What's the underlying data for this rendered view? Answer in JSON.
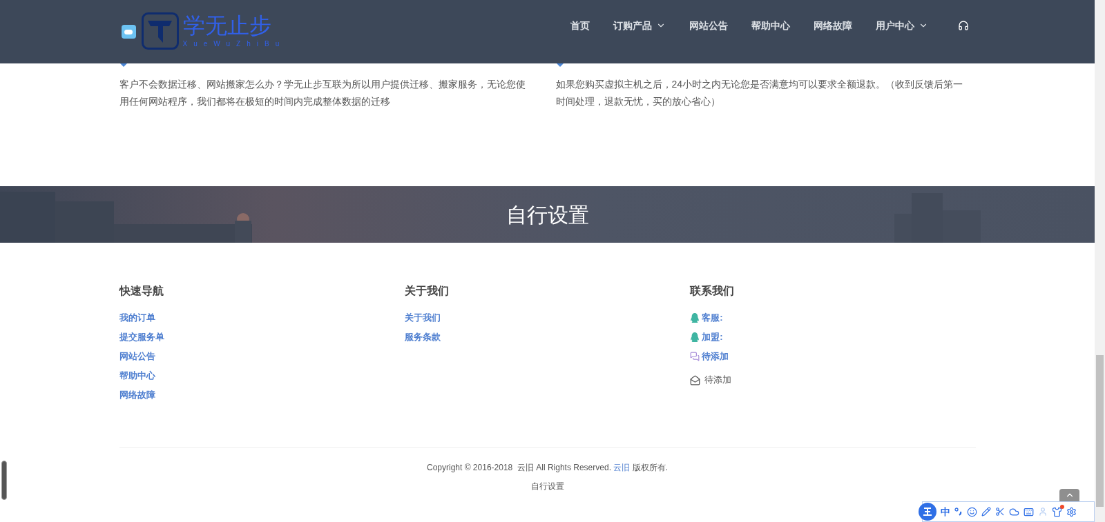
{
  "header": {
    "logo_title": "学无止步",
    "logo_subtitle": "XueWuZhiBu",
    "nav": [
      {
        "label": "首页",
        "dropdown": false
      },
      {
        "label": "订购产品",
        "dropdown": true
      },
      {
        "label": "网站公告",
        "dropdown": false
      },
      {
        "label": "帮助中心",
        "dropdown": false
      },
      {
        "label": "网络故障",
        "dropdown": false
      },
      {
        "label": "用户中心",
        "dropdown": true
      }
    ]
  },
  "features": [
    {
      "text": "客户不会数据迁移、网站搬家怎么办？学无止步互联为所以用户提供迁移、搬家服务，无论您使用任何网站程序，我们都将在极短的时间内完成整体数据的迁移"
    },
    {
      "text": "如果您购买虚拟主机之后，24小时之内无论您是否满意均可以要求全额退款。（收到反馈后第一时间处理，退款无忧，买的放心省心）"
    }
  ],
  "banner": {
    "kind": "picture",
    "title": "自行设置"
  },
  "footer": {
    "columns": [
      {
        "title": "快速导航",
        "links": [
          {
            "label": "我的订单"
          },
          {
            "label": "提交服务单"
          },
          {
            "label": "网站公告"
          },
          {
            "label": "帮助中心"
          },
          {
            "label": "网络故障"
          }
        ]
      },
      {
        "title": "关于我们",
        "links": [
          {
            "label": "关于我们"
          },
          {
            "label": "服务条款"
          }
        ]
      }
    ],
    "contact": {
      "title": "联系我们",
      "items": [
        {
          "kind": "qq",
          "label": "客服:"
        },
        {
          "kind": "qq",
          "label": "加盟:"
        },
        {
          "kind": "chat",
          "label": "待添加"
        },
        {
          "kind": "mail",
          "label": "待添加"
        }
      ]
    },
    "copyright": {
      "before": "Copyright © 2016-2018  云旧 All Rights Reserved. ",
      "link": "云旧",
      "after": " 版权所有."
    },
    "bottom_text": "自行设置"
  },
  "ime": {
    "mode": "中"
  }
}
